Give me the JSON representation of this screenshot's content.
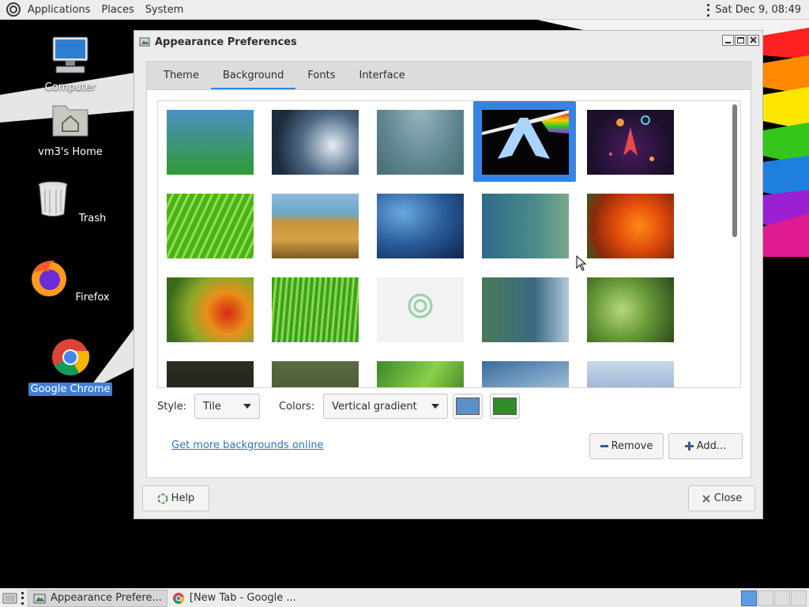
{
  "top_panel": {
    "menu": [
      "Applications",
      "Places",
      "System"
    ],
    "clock": "Sat Dec 9, 08:49"
  },
  "desktop": {
    "icons": [
      {
        "label": "Computer",
        "icon": "computer-icon"
      },
      {
        "label": "vm3's Home",
        "icon": "home-folder-icon"
      },
      {
        "label": "Trash",
        "icon": "trash-icon"
      },
      {
        "label": "Firefox",
        "icon": "firefox-icon"
      },
      {
        "label": "Google Chrome",
        "icon": "chrome-icon",
        "selected": true
      }
    ]
  },
  "dialog": {
    "title": "Appearance Preferences",
    "tabs": [
      {
        "label": "Theme",
        "active": false
      },
      {
        "label": "Background",
        "active": true
      },
      {
        "label": "Fonts",
        "active": false
      },
      {
        "label": "Interface",
        "active": false
      }
    ],
    "style_label": "Style:",
    "style_value": "Tile",
    "colors_label": "Colors:",
    "colors_value": "Vertical gradient",
    "primary_color": "#5b8fc7",
    "secondary_color": "#2e8c2a",
    "link": "Get more backgrounds online",
    "remove_button": "Remove",
    "add_button": "Add...",
    "help_button": "Help",
    "close_button": "Close",
    "selected_wallpaper_index": 3
  },
  "taskbar": {
    "tasks": [
      {
        "label": "Appearance Prefere...",
        "active": true
      },
      {
        "label": "[New Tab - Google ...",
        "active": false
      }
    ]
  }
}
